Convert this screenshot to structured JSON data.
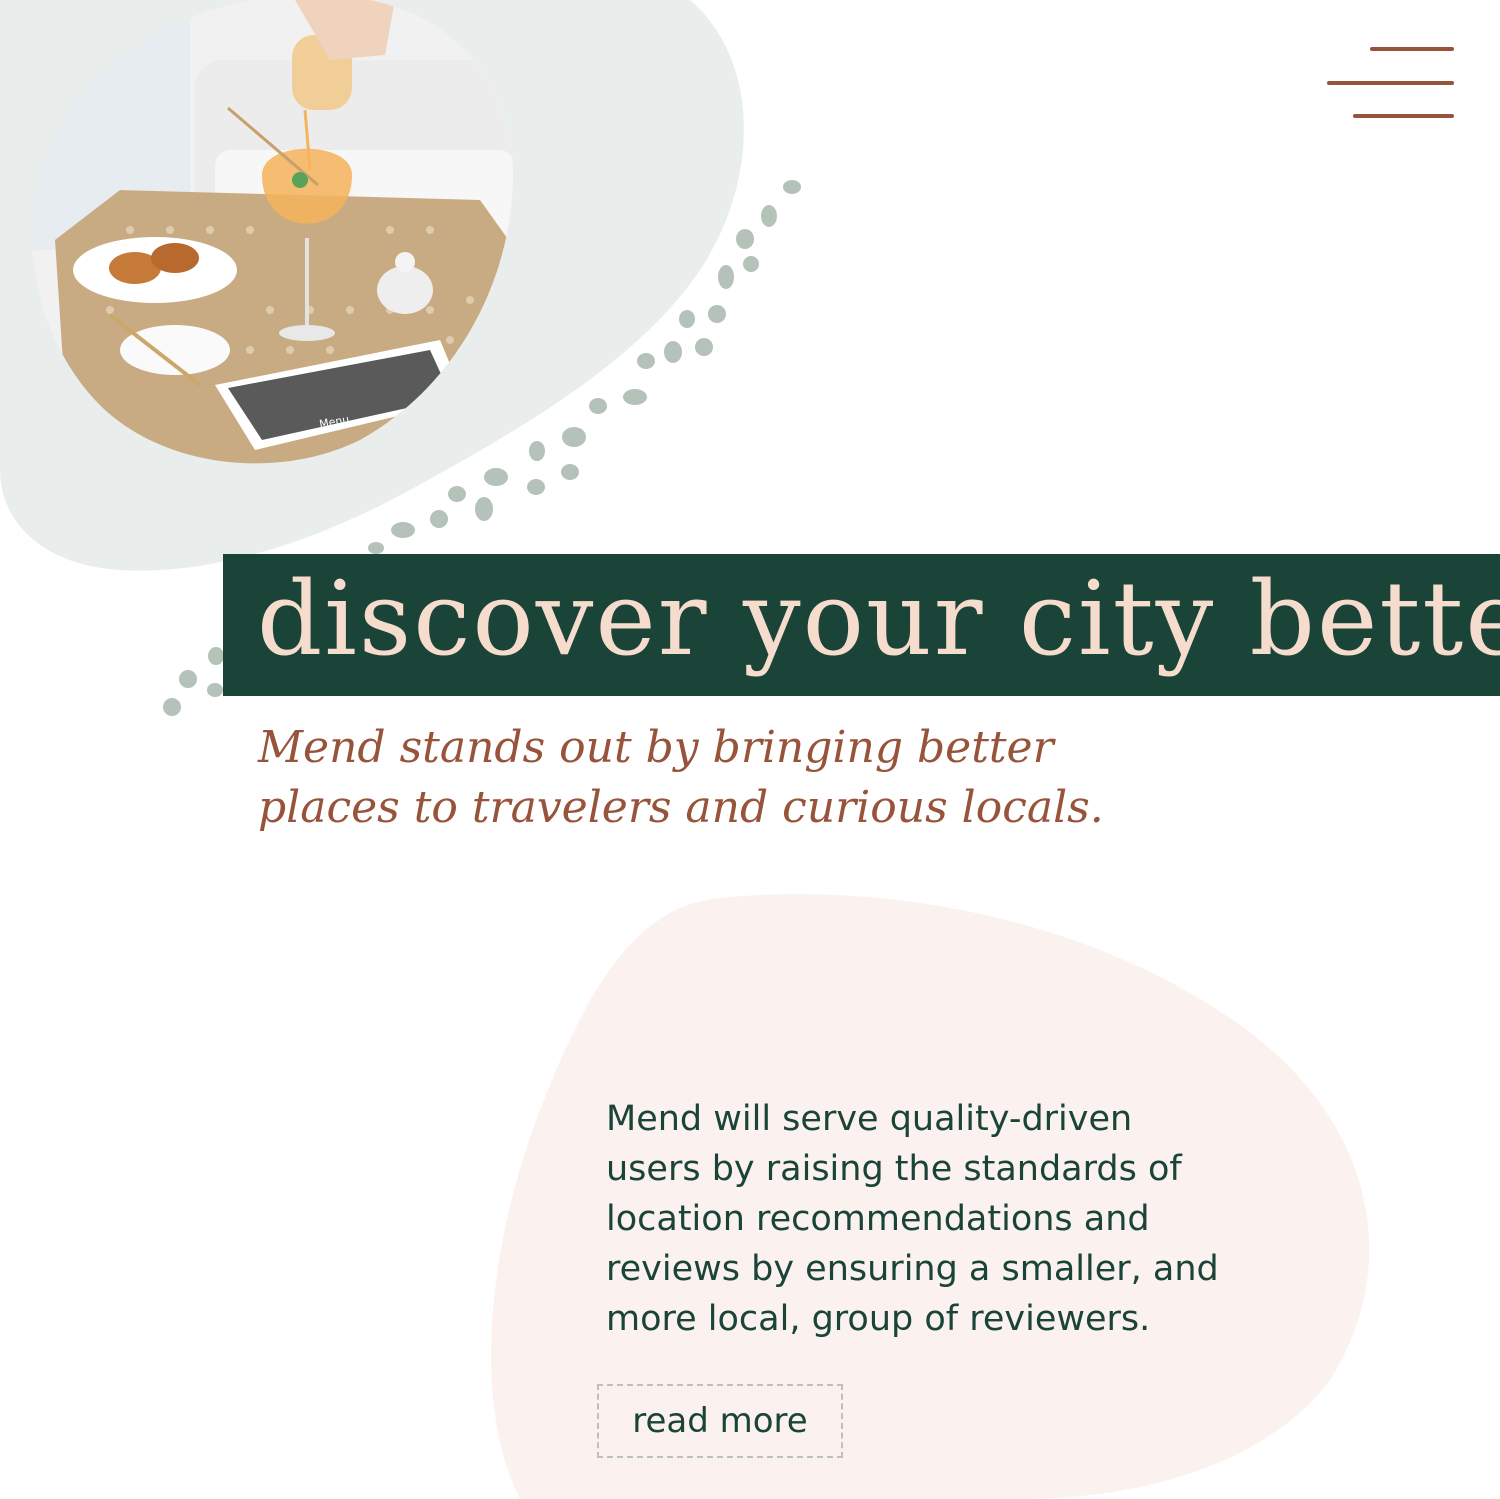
{
  "hero": {
    "title": "discover your city better",
    "subtitle_line1": "Mend stands out by bringing better",
    "subtitle_line2": "places to travelers and curious locals."
  },
  "photo": {
    "icon": "cafe-table-drink-photo",
    "menu_card_text": "Menu"
  },
  "about": {
    "description_lines": [
      "Mend will serve quality-driven",
      "users by raising the standards of",
      "location recommendations and",
      "reviews by ensuring a smaller, and",
      "more local, group of reviewers."
    ],
    "cta_label": "read more"
  },
  "nav": {
    "menu_icon": "hamburger-menu-icon"
  },
  "colors": {
    "dark_green": "#1b4439",
    "rust": "#98533b",
    "peach_text": "#f6dccd",
    "sage_blob": "#e9eeec",
    "sage_dots": "#b4c2b9",
    "blush_blob": "#fbf2ef"
  }
}
